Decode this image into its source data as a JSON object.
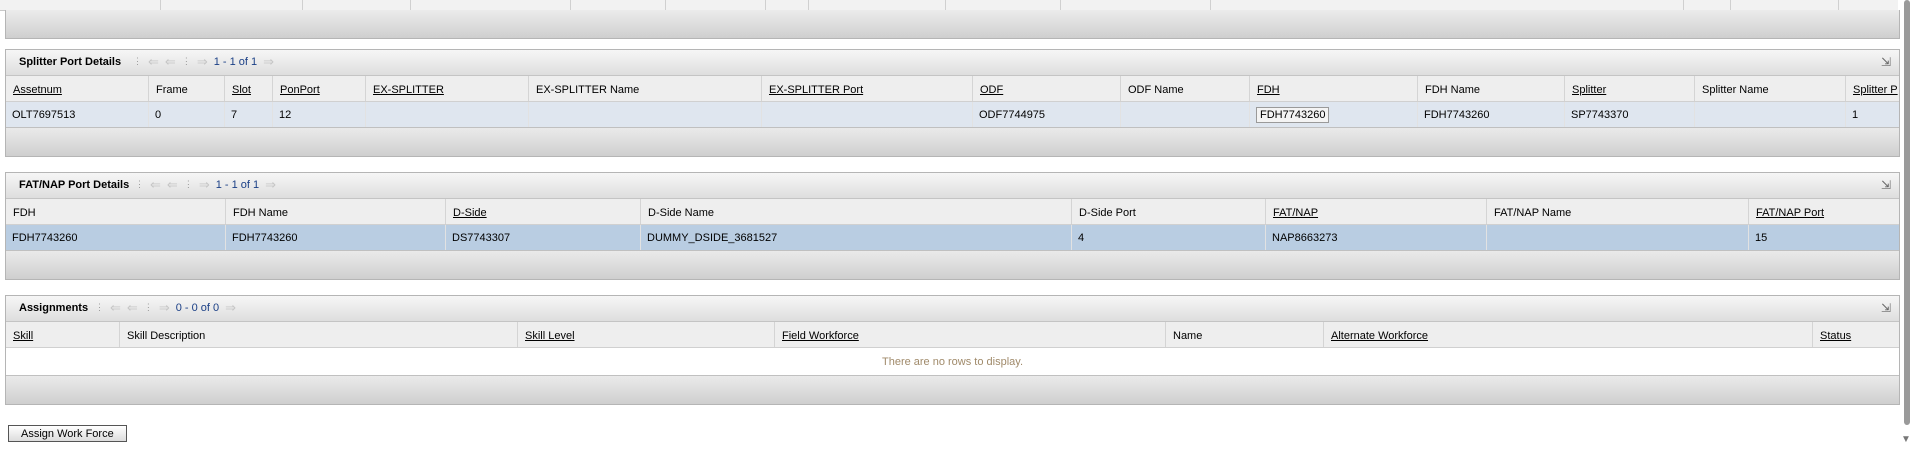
{
  "splitter_section": {
    "title": "Splitter Port Details",
    "page_count": "1 - 1 of 1",
    "columns": [
      "Assetnum",
      "Frame",
      "Slot",
      "PonPort",
      "EX-SPLITTER",
      "EX-SPLITTER Name",
      "EX-SPLITTER Port",
      "ODF",
      "ODF Name",
      "FDH",
      "FDH Name",
      "Splitter",
      "Splitter Name",
      "Splitter P"
    ],
    "row": [
      "OLT7697513",
      "0",
      "7",
      "12",
      "",
      "",
      "",
      "ODF7744975",
      "",
      "FDH7743260",
      "FDH7743260",
      "SP7743370",
      "",
      "1"
    ]
  },
  "fat_section": {
    "title": "FAT/NAP Port Details",
    "page_count": "1 - 1 of 1",
    "columns": [
      "FDH",
      "FDH Name",
      "D-Side",
      "D-Side Name",
      "D-Side Port",
      "FAT/NAP",
      "FAT/NAP Name",
      "FAT/NAP Port"
    ],
    "row": [
      "FDH7743260",
      "FDH7743260",
      "DS7743307",
      "DUMMY_DSIDE_3681527",
      "4",
      "NAP8663273",
      "",
      "15"
    ]
  },
  "assign_section": {
    "title": "Assignments",
    "page_count": "0 - 0 of 0",
    "columns": [
      "Skill",
      "Skill Description",
      "Skill Level",
      "Field Workforce",
      "Name",
      "Alternate Workforce",
      "Status"
    ],
    "empty_text": "There are no rows to display."
  },
  "assign_button": "Assign Work Force",
  "icons": {
    "nav": [
      "first-page-icon",
      "prev-page-icon",
      "next-page-icon",
      "last-page-icon"
    ],
    "export": "export-icon"
  }
}
